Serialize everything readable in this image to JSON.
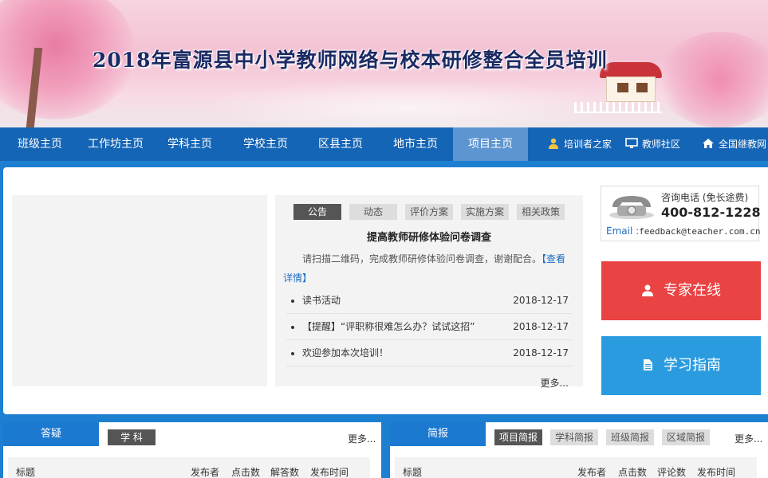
{
  "banner": {
    "title": "2018年富源县中小学教师网络与校本研修整合全员培训"
  },
  "nav": {
    "items": [
      {
        "label": "班级主页"
      },
      {
        "label": "工作坊主页"
      },
      {
        "label": "学科主页"
      },
      {
        "label": "学校主页"
      },
      {
        "label": "区县主页"
      },
      {
        "label": "地市主页"
      },
      {
        "label": "项目主页"
      }
    ],
    "active": "项目主页",
    "external": [
      {
        "label": "培训者之家",
        "icon": "person-icon"
      },
      {
        "label": "教师社区",
        "icon": "monitor-icon"
      },
      {
        "label": "全国继教网",
        "icon": "home-icon"
      }
    ]
  },
  "news": {
    "tabs": [
      {
        "label": "公告"
      },
      {
        "label": "动态"
      },
      {
        "label": "评价方案"
      },
      {
        "label": "实施方案"
      },
      {
        "label": "相关政策"
      }
    ],
    "active_tab": "公告",
    "headline": "提高教师研修体验问卷调查",
    "summary": "请扫描二维码，完成教师研修体验问卷调查，谢谢配合。",
    "summary_link": "【查看详情】",
    "items": [
      {
        "title": "读书活动",
        "date": "2018-12-17"
      },
      {
        "title": "【提醒】“评职称很难怎么办？试试这招”",
        "date": "2018-12-17"
      },
      {
        "title": "欢迎参加本次培训！",
        "date": "2018-12-17"
      }
    ],
    "more": "更多..."
  },
  "contact": {
    "label": "咨询电话",
    "label_note": "(免长途费)",
    "phone": "400-812-1228",
    "email_label": "Email :",
    "email": "feedback@teacher.com.cn"
  },
  "buttons": {
    "expert": "专家在线",
    "guide": "学习指南",
    "expert_color": "#e94343",
    "guide_color": "#2b9be0"
  },
  "qa_panel": {
    "title": "答疑",
    "tab": "学 科",
    "more": "更多...",
    "columns": [
      "标题",
      "发布者",
      "点击数",
      "解答数",
      "发布时间"
    ]
  },
  "brief_panel": {
    "title": "简报",
    "tabs": [
      {
        "label": "项目简报"
      },
      {
        "label": "学科简报"
      },
      {
        "label": "班级简报"
      },
      {
        "label": "区域简报"
      }
    ],
    "active_tab": "项目简报",
    "more": "更多...",
    "columns": [
      "标题",
      "发布者",
      "点击数",
      "评论数",
      "发布时间"
    ]
  }
}
